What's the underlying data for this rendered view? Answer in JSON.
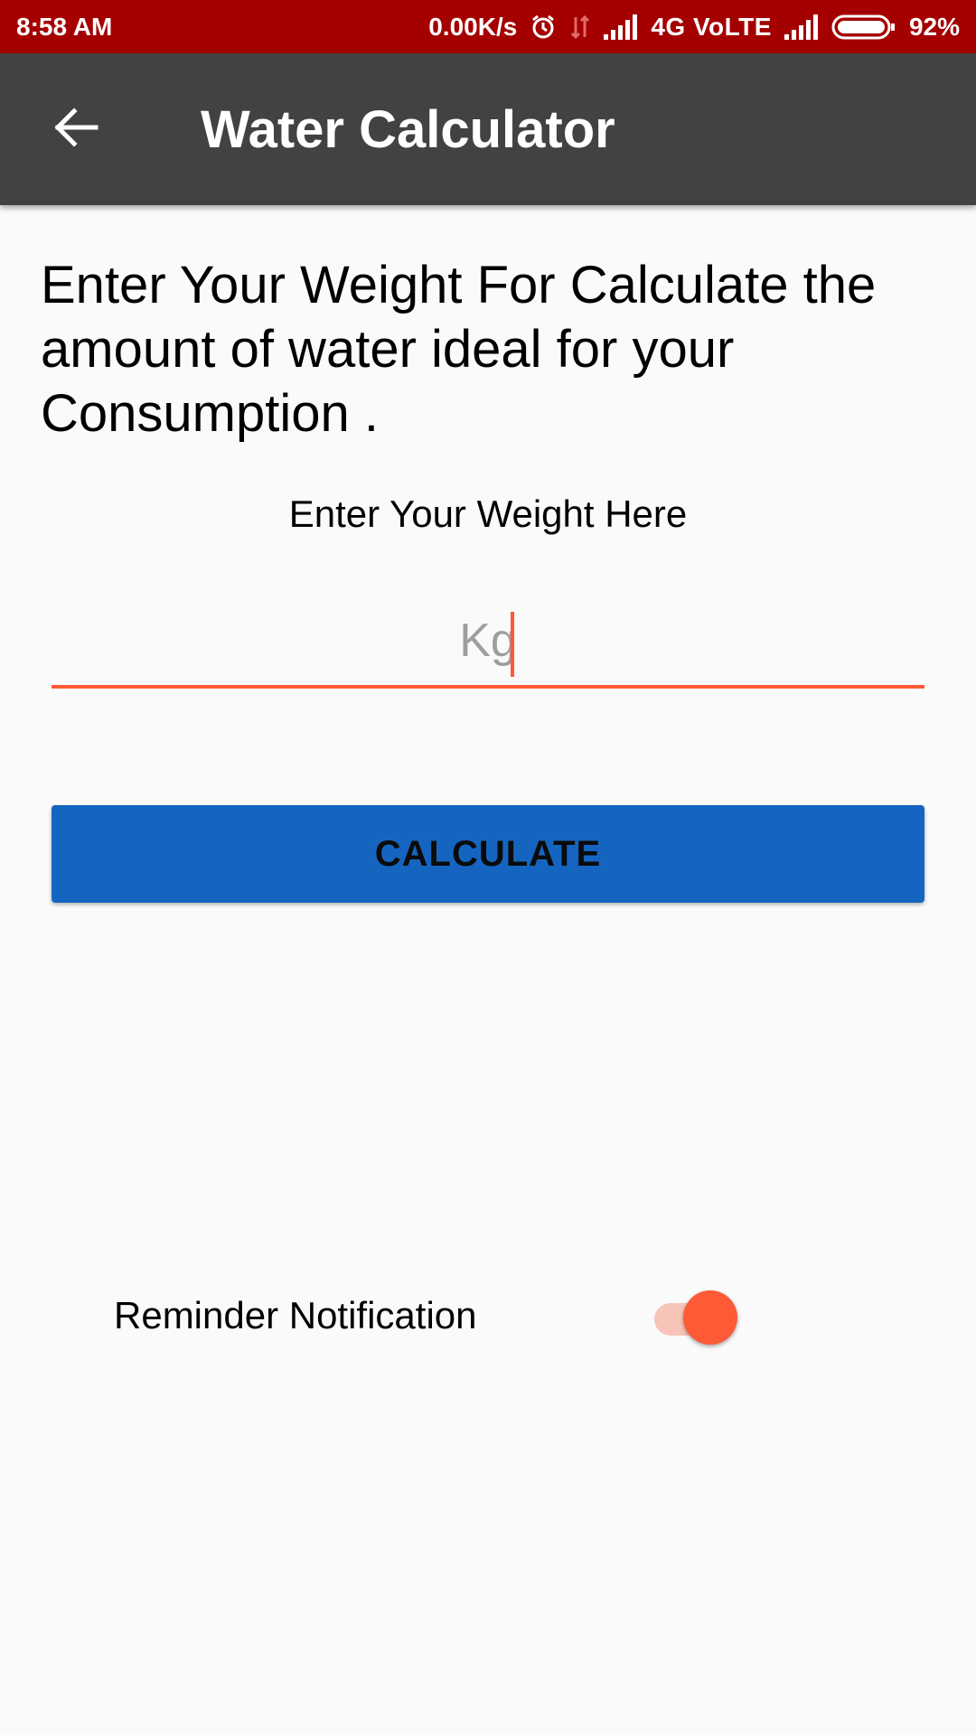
{
  "status_bar": {
    "time": "8:58 AM",
    "net_speed": "0.00K/s",
    "network": "4G VoLTE",
    "battery": "92%",
    "icons": [
      "alarm-icon",
      "data-arrows-icon",
      "signal-icon",
      "signal-icon",
      "battery-icon"
    ]
  },
  "app_bar": {
    "title": "Water Calculator",
    "back_icon": "arrow-left-icon"
  },
  "main": {
    "intro": "Enter Your Weight For Calculate the amount of water ideal for your Consumption .",
    "weight_label": "Enter Your Weight Here",
    "weight_input": {
      "placeholder": "Kg",
      "value": ""
    },
    "calculate_label": "CALCULATE",
    "reminder_label": "Reminder Notification",
    "reminder_enabled": true
  },
  "colors": {
    "status_bar": "#a40000",
    "app_bar": "#424242",
    "accent": "#ff5a36",
    "button": "#1565c0",
    "background": "#fafafa"
  }
}
